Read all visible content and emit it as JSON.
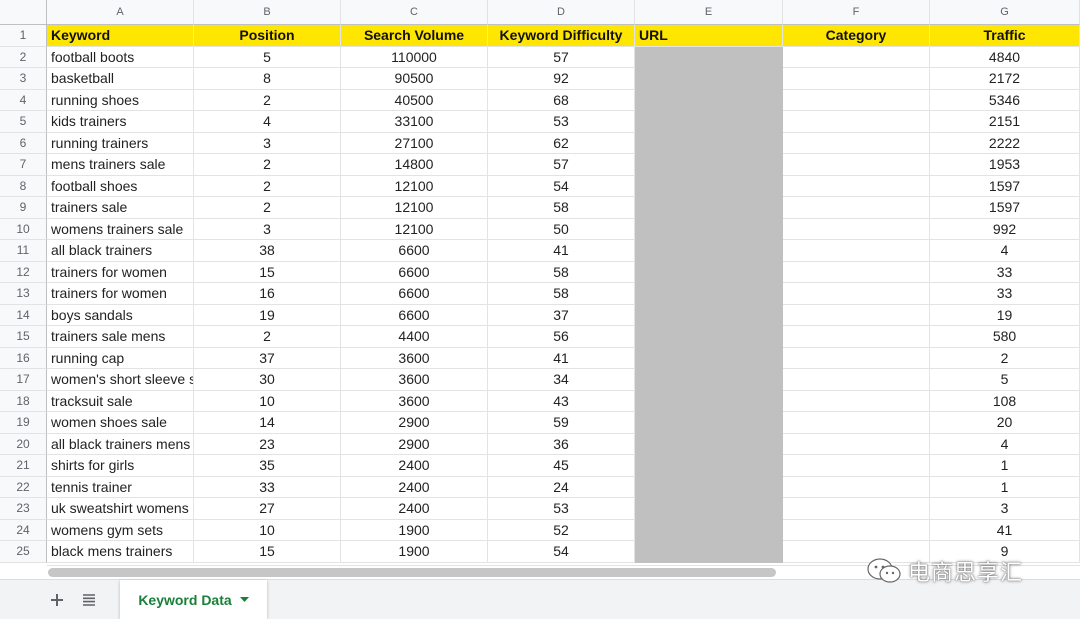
{
  "columns": [
    "A",
    "B",
    "C",
    "D",
    "E",
    "F",
    "G"
  ],
  "header": [
    "Keyword",
    "Position",
    "Search Volume",
    "Keyword Difficulty",
    "URL",
    "Category",
    "Traffic"
  ],
  "rows": [
    {
      "n": "2",
      "kw": "football boots",
      "pos": "5",
      "vol": "110000",
      "kd": "57",
      "traffic": "4840"
    },
    {
      "n": "3",
      "kw": "basketball",
      "pos": "8",
      "vol": "90500",
      "kd": "92",
      "traffic": "2172"
    },
    {
      "n": "4",
      "kw": "running shoes",
      "pos": "2",
      "vol": "40500",
      "kd": "68",
      "traffic": "5346"
    },
    {
      "n": "5",
      "kw": "kids trainers",
      "pos": "4",
      "vol": "33100",
      "kd": "53",
      "traffic": "2151"
    },
    {
      "n": "6",
      "kw": "running trainers",
      "pos": "3",
      "vol": "27100",
      "kd": "62",
      "traffic": "2222"
    },
    {
      "n": "7",
      "kw": "mens trainers sale",
      "pos": "2",
      "vol": "14800",
      "kd": "57",
      "traffic": "1953"
    },
    {
      "n": "8",
      "kw": "football shoes",
      "pos": "2",
      "vol": "12100",
      "kd": "54",
      "traffic": "1597"
    },
    {
      "n": "9",
      "kw": "trainers sale",
      "pos": "2",
      "vol": "12100",
      "kd": "58",
      "traffic": "1597"
    },
    {
      "n": "10",
      "kw": "womens trainers sale",
      "pos": "3",
      "vol": "12100",
      "kd": "50",
      "traffic": "992"
    },
    {
      "n": "11",
      "kw": "all black trainers",
      "pos": "38",
      "vol": "6600",
      "kd": "41",
      "traffic": "4"
    },
    {
      "n": "12",
      "kw": "trainers for women",
      "pos": "15",
      "vol": "6600",
      "kd": "58",
      "traffic": "33"
    },
    {
      "n": "13",
      "kw": "trainers for women",
      "pos": "16",
      "vol": "6600",
      "kd": "58",
      "traffic": "33"
    },
    {
      "n": "14",
      "kw": "boys sandals",
      "pos": "19",
      "vol": "6600",
      "kd": "37",
      "traffic": "19"
    },
    {
      "n": "15",
      "kw": "trainers sale mens",
      "pos": "2",
      "vol": "4400",
      "kd": "56",
      "traffic": "580"
    },
    {
      "n": "16",
      "kw": "running cap",
      "pos": "37",
      "vol": "3600",
      "kd": "41",
      "traffic": "2"
    },
    {
      "n": "17",
      "kw": "women's short sleeve s",
      "pos": "30",
      "vol": "3600",
      "kd": "34",
      "traffic": "5"
    },
    {
      "n": "18",
      "kw": "tracksuit sale",
      "pos": "10",
      "vol": "3600",
      "kd": "43",
      "traffic": "108"
    },
    {
      "n": "19",
      "kw": "women shoes sale",
      "pos": "14",
      "vol": "2900",
      "kd": "59",
      "traffic": "20"
    },
    {
      "n": "20",
      "kw": "all black trainers mens",
      "pos": "23",
      "vol": "2900",
      "kd": "36",
      "traffic": "4"
    },
    {
      "n": "21",
      "kw": "shirts for girls",
      "pos": "35",
      "vol": "2400",
      "kd": "45",
      "traffic": "1"
    },
    {
      "n": "22",
      "kw": "tennis trainer",
      "pos": "33",
      "vol": "2400",
      "kd": "24",
      "traffic": "1"
    },
    {
      "n": "23",
      "kw": "uk sweatshirt womens",
      "pos": "27",
      "vol": "2400",
      "kd": "53",
      "traffic": "3"
    },
    {
      "n": "24",
      "kw": "womens gym sets",
      "pos": "10",
      "vol": "1900",
      "kd": "52",
      "traffic": "41"
    },
    {
      "n": "25",
      "kw": "black mens trainers",
      "pos": "15",
      "vol": "1900",
      "kd": "54",
      "traffic": "9"
    }
  ],
  "sheet_tab": {
    "label": "Keyword Data"
  },
  "watermark": {
    "text": "电商思享汇"
  },
  "colors": {
    "header_fill": "#ffe600",
    "redacted": "#c0c0c0",
    "tab_text": "#188038"
  }
}
